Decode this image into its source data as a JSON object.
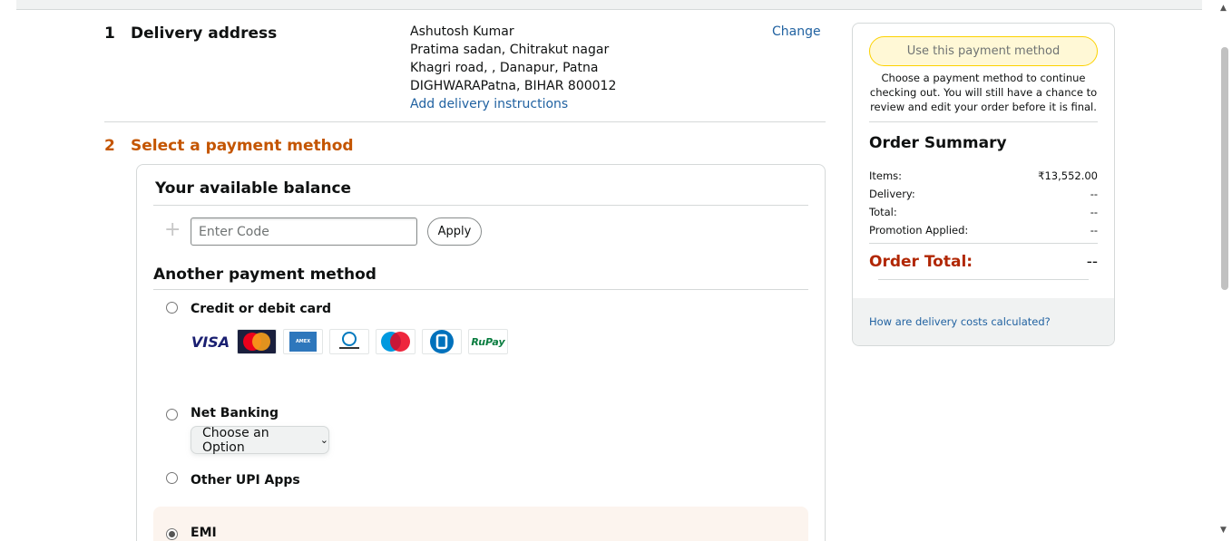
{
  "delivery": {
    "step_number": "1",
    "title": "Delivery address",
    "address_lines": [
      "Ashutosh Kumar",
      "Pratima sadan, Chitrakut nagar",
      "Khagri road, , Danapur, Patna",
      "DIGHWARAPatna, BIHAR 800012"
    ],
    "instructions_link": "Add delivery instructions",
    "change_link": "Change"
  },
  "payment": {
    "step_number": "2",
    "title": "Select a payment method",
    "balance_title": "Your available balance",
    "code_placeholder": "Enter Code",
    "apply_label": "Apply",
    "another_title": "Another payment method",
    "options": {
      "card": "Credit or debit card",
      "net_banking": "Net Banking",
      "net_banking_select": "Choose an Option",
      "upi": "Other UPI Apps",
      "emi": "EMI"
    },
    "selected_option": "EMI",
    "card_logos": [
      "VISA",
      "MasterCard",
      "American Express",
      "Diners Club International",
      "Maestro",
      "Bajaj Finserv",
      "RuPay"
    ]
  },
  "summary": {
    "use_button": "Use this payment method",
    "note": "Choose a payment method to continue checking out. You will still have a chance to review and edit your order before it is final.",
    "title": "Order Summary",
    "rows": [
      {
        "label": "Items:",
        "value": "₹13,552.00"
      },
      {
        "label": "Delivery:",
        "value": "--"
      },
      {
        "label": "Total:",
        "value": "--"
      },
      {
        "label": "Promotion Applied:",
        "value": "--"
      }
    ],
    "order_total_label": "Order Total:",
    "order_total_value": "--",
    "footer_link": "How are delivery costs calculated?"
  },
  "colors": {
    "accent": "#c45500",
    "link": "#2162a1",
    "total_red": "#b12704",
    "button_yellow": "#fff8d6"
  }
}
